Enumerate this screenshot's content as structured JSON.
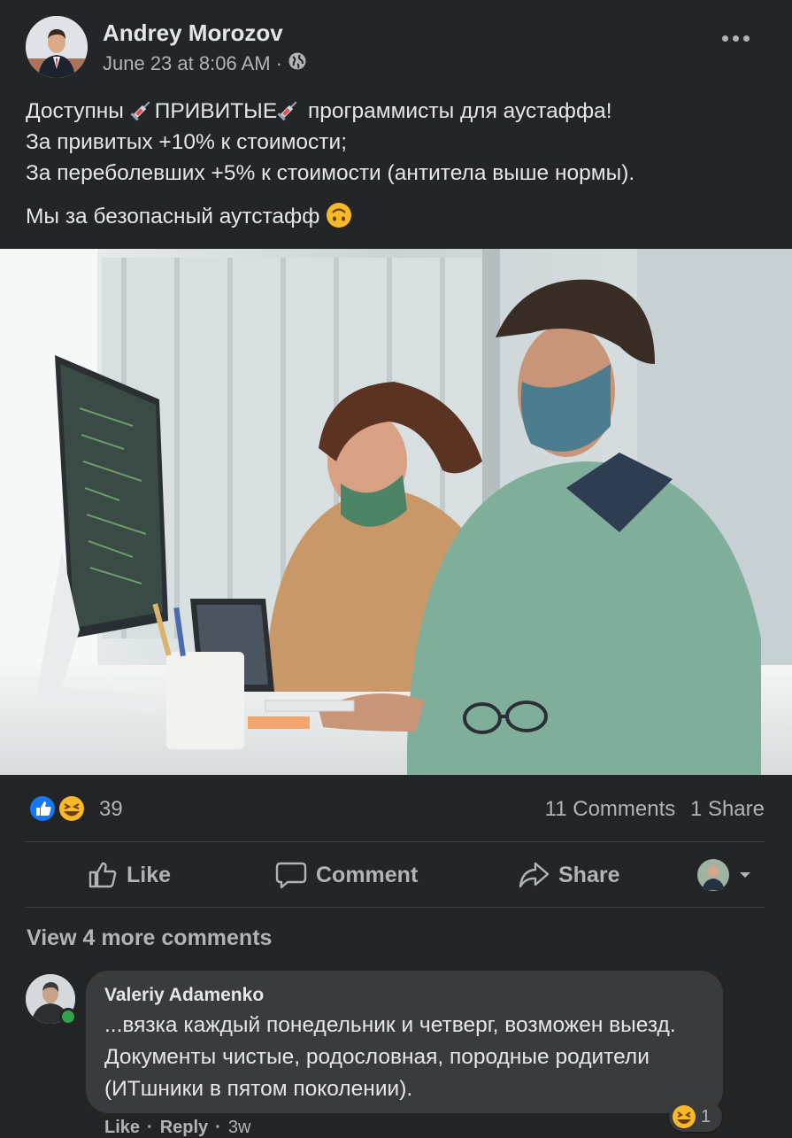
{
  "post": {
    "author": "Andrey Morozov",
    "timestamp": "June 23 at 8:06 AM",
    "separator": "·",
    "privacy_icon": "globe-icon",
    "text": {
      "line1_a": "Доступны ",
      "line1_b": "ПРИВИТЫЕ",
      "line1_c": " программисты для аустаффа!",
      "line2": "За привитых +10% к стоимости;",
      "line3": "За переболевших +5% к стоимости (антитела выше нормы).",
      "line4": "Мы за безопасный аутстафф"
    }
  },
  "stats": {
    "reactions": [
      "like-icon",
      "haha-icon"
    ],
    "reaction_count": "39",
    "comments": "11 Comments",
    "shares": "1 Share"
  },
  "actions": {
    "like": "Like",
    "comment": "Comment",
    "share": "Share"
  },
  "comments": {
    "view_more": "View 4 more comments",
    "items": [
      {
        "author": "Valeriy Adamenko",
        "text": "...вязка каждый понедельник и четверг, возможен выезд. Документы чистые, родословная, породные родители (ИТшники в пятом поколении).",
        "reaction_count": "1",
        "like": "Like",
        "dot": "·",
        "reply": "Reply",
        "time": "3w"
      }
    ]
  },
  "colors": {
    "background": "#242526",
    "bubble": "#3a3b3c",
    "text_primary": "#e4e6eb",
    "text_secondary": "#b0b3b8",
    "like_blue": "#1877f2",
    "online_green": "#31a24c"
  }
}
